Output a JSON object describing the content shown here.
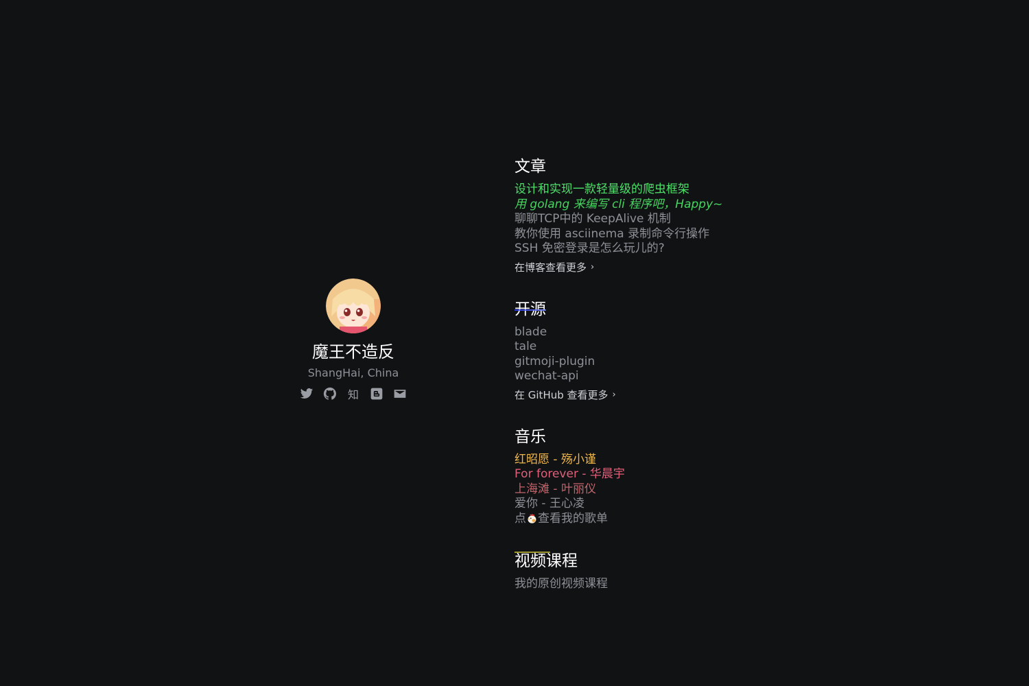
{
  "profile": {
    "name": "魔王不造反",
    "location": "ShangHai, China",
    "social": [
      {
        "icon": "twitter-icon"
      },
      {
        "icon": "github-icon"
      },
      {
        "icon": "zhihu-icon",
        "glyph": "知"
      },
      {
        "icon": "blogger-icon"
      },
      {
        "icon": "mail-icon"
      }
    ]
  },
  "sections": {
    "articles": {
      "title": "文章",
      "items": [
        "设计和实现一款轻量级的爬虫框架",
        "用 golang 来编写 cli 程序吧，Happy~",
        "聊聊TCP中的 KeepAlive 机制",
        "教你使用 asciinema 录制命令行操作",
        "SSH 免密登录是怎么玩儿的?"
      ],
      "more": "在博客查看更多"
    },
    "opensource": {
      "title": "开源",
      "items": [
        "blade",
        "tale",
        "gitmoji-plugin",
        "wechat-api"
      ],
      "more": "在 GitHub 查看更多"
    },
    "music": {
      "title": "音乐",
      "items": [
        "红昭愿 - 殇小谨",
        "For forever - 华晨宇",
        "上海滩 - 叶丽仪",
        "爱你 - 王心凌"
      ],
      "playlist_prefix": "点",
      "playlist_icon": "chicken-icon",
      "playlist_suffix": "查看我的歌单"
    },
    "courses": {
      "title": "视频课程",
      "items": [
        "我的原创视频课程"
      ]
    }
  },
  "colors": {
    "background": "#111214",
    "text_muted": "#8d9096",
    "heading": "#ffffff",
    "accent_green": "#4ee06a",
    "accent_blue": "#2b3cff",
    "accent_orange": "#f0b64a",
    "accent_pink": "#e0607a",
    "accent_yellow": "#e5dd5a"
  }
}
